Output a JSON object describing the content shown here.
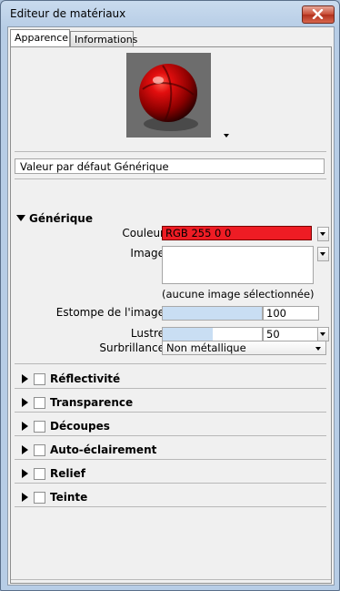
{
  "window": {
    "title": "Editeur de matériaux"
  },
  "tabs": [
    {
      "label": "Apparence",
      "active": true
    },
    {
      "label": "Informations",
      "active": false
    }
  ],
  "material_name": "Valeur par défaut Générique",
  "generic": {
    "header": "Générique",
    "color_label": "Couleur",
    "color_value": "RGB 255 0 0",
    "color_swatch": "#ee1c24",
    "image_label": "Image",
    "image_status": "(aucune image sélectionnée)",
    "image_fade_label": "Estompe de l'image",
    "image_fade_value": "100",
    "image_fade_fraction": 1.0,
    "gloss_label": "Lustre",
    "gloss_value": "50",
    "gloss_fraction": 0.5,
    "highlights_label": "Surbrillance",
    "highlights_value": "Non métallique"
  },
  "sections": [
    {
      "label": "Réflectivité",
      "checked": false
    },
    {
      "label": "Transparence",
      "checked": false
    },
    {
      "label": "Découpes",
      "checked": false
    },
    {
      "label": "Auto-éclairement",
      "checked": false
    },
    {
      "label": "Relief",
      "checked": false
    },
    {
      "label": "Teinte",
      "checked": false
    }
  ],
  "icons": {
    "close": "close-icon",
    "preview_options": "chevron-down-icon",
    "add_material": "sphere-add-icon",
    "material_list": "list-view-icon"
  }
}
